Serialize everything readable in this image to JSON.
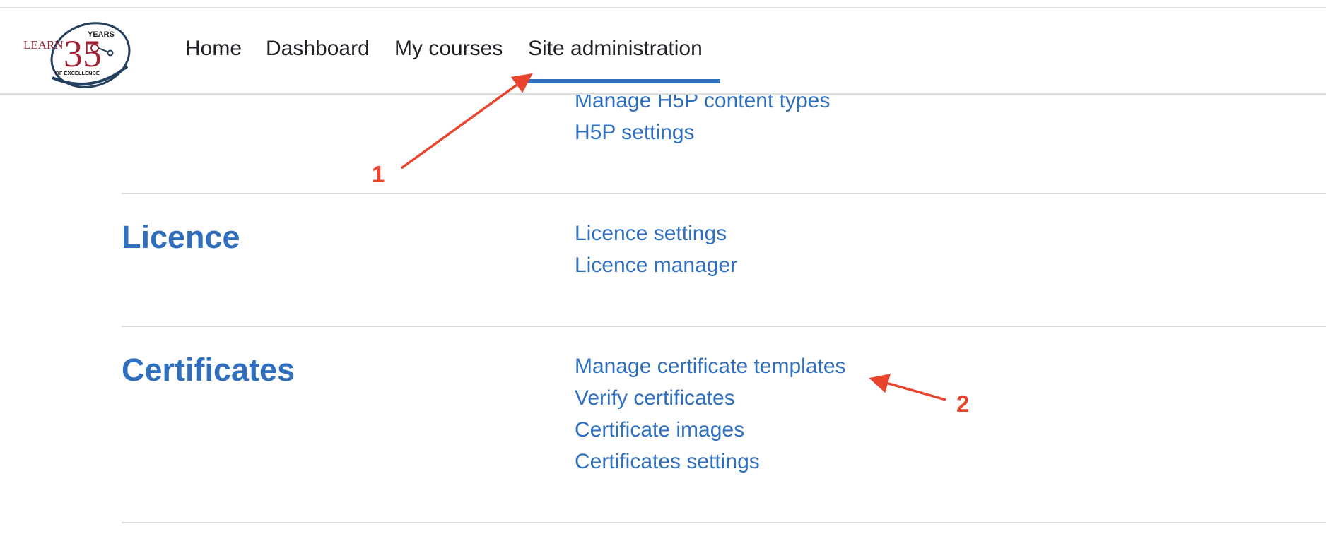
{
  "navbar": {
    "logo": {
      "word": "LEARN",
      "number": "35",
      "years": "YEARS",
      "tagline": "OF EXCELLENCE"
    },
    "items": [
      {
        "label": "Home"
      },
      {
        "label": "Dashboard"
      },
      {
        "label": "My courses"
      },
      {
        "label": "Site administration",
        "active": true
      }
    ]
  },
  "sections": [
    {
      "title": "",
      "links": [
        "Manage H5P content types",
        "H5P settings"
      ]
    },
    {
      "title": "Licence",
      "links": [
        "Licence settings",
        "Licence manager"
      ]
    },
    {
      "title": "Certificates",
      "links": [
        "Manage certificate templates",
        "Verify certificates",
        "Certificate images",
        "Certificates settings"
      ]
    }
  ],
  "annotations": [
    {
      "label": "1"
    },
    {
      "label": "2"
    }
  ],
  "colors": {
    "link": "#2f6fbd",
    "annotation": "#e8442e",
    "logo_red": "#9c2434",
    "logo_navy": "#24405e"
  }
}
